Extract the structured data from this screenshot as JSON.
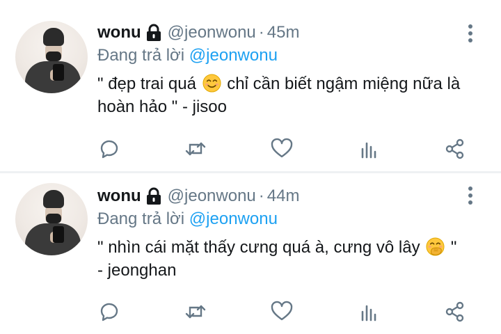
{
  "tweets": [
    {
      "name": "wonu",
      "handle": "@jeonwonu",
      "separator": "·",
      "time": "45m",
      "reply_prefix": "Đang trả lời",
      "reply_to": "@jeonwonu",
      "text_before_emoji": "\" đẹp trai quá",
      "emoji": "smiling-face-icon",
      "text_after_emoji": "chỉ cần biết ngậm miệng nữa là hoàn hảo \" - jisoo"
    },
    {
      "name": "wonu",
      "handle": "@jeonwonu",
      "separator": "·",
      "time": "44m",
      "reply_prefix": "Đang trả lời",
      "reply_to": "@jeonwonu",
      "text_before_emoji": "\" nhìn cái mặt thấy cưng quá à, cưng vô lây",
      "emoji": "hand-over-mouth-face-icon",
      "text_after_emoji": "\" - jeonghan"
    }
  ],
  "icons": {
    "lock": "lock-icon",
    "more": "more-vertical-icon",
    "reply": "reply-icon",
    "retweet": "retweet-icon",
    "like": "heart-icon",
    "stats": "analytics-icon",
    "share": "share-icon"
  },
  "colors": {
    "name": "#14171a",
    "muted": "#657786",
    "mention": "#1da1f2",
    "divider": "#eef1f3",
    "emoji_face": "#ffc83d"
  }
}
